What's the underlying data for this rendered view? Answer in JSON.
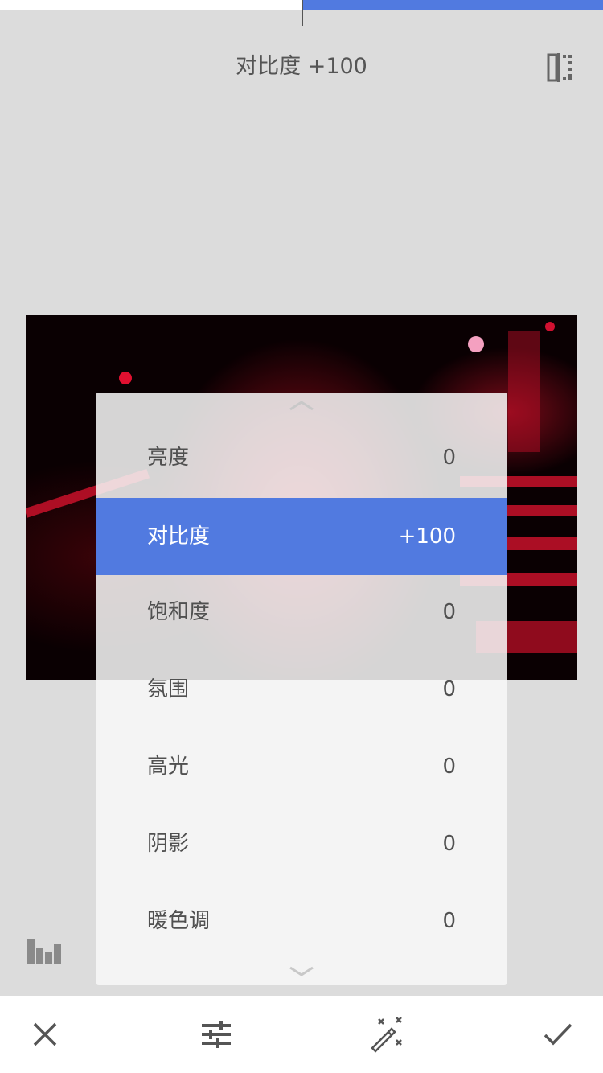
{
  "header": {
    "title": "对比度 +100"
  },
  "adjustment": {
    "name": "对比度",
    "value": 100,
    "range": [
      -100,
      100
    ]
  },
  "menu": {
    "items": [
      {
        "label": "亮度",
        "value": "0"
      },
      {
        "label": "对比度",
        "value": "+100"
      },
      {
        "label": "饱和度",
        "value": "0"
      },
      {
        "label": "氛围",
        "value": "0"
      },
      {
        "label": "高光",
        "value": "0"
      },
      {
        "label": "阴影",
        "value": "0"
      },
      {
        "label": "暖色调",
        "value": "0"
      }
    ],
    "selected_index": 1
  },
  "icons": {
    "compare": "compare-icon",
    "histogram": "histogram-icon",
    "scroll_up": "chevron-up-icon",
    "scroll_down": "chevron-down-icon",
    "cancel": "close-icon",
    "adjust": "tune-sliders-icon",
    "auto": "magic-wand-icon",
    "apply": "check-icon"
  },
  "colors": {
    "accent": "#517ae0",
    "background": "#dcdcdc",
    "text": "#555555"
  }
}
